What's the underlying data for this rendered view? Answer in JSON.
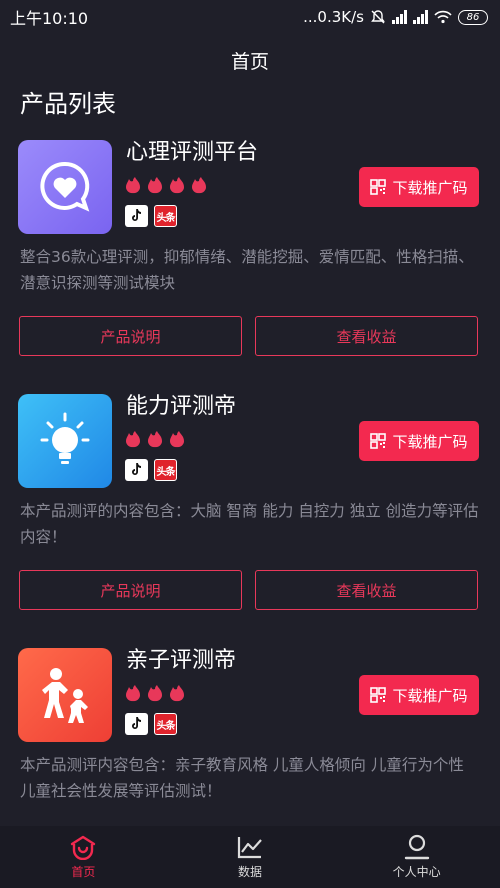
{
  "status": {
    "time": "上午10:10",
    "network": "...0.3K/s",
    "battery": "86"
  },
  "header": {
    "title": "首页"
  },
  "section_title": "产品列表",
  "products": [
    {
      "name": "心理评测平台",
      "rating": 4,
      "badge_toutiao": "头条",
      "qr_label": "下载推广码",
      "description": "整合36款心理评测，抑郁情绪、潜能挖掘、爱情匹配、性格扫描、潜意识探测等测试模块",
      "left_button": "产品说明",
      "right_button": "查看收益",
      "icon_color": "#8f7cf8"
    },
    {
      "name": "能力评测帝",
      "rating": 3,
      "badge_toutiao": "头条",
      "qr_label": "下载推广码",
      "description": "本产品测评的内容包含：大脑 智商 能力 自控力 独立 创造力等评估内容！",
      "left_button": "产品说明",
      "right_button": "查看收益",
      "icon_color": "#2fa8f2"
    },
    {
      "name": "亲子评测帝",
      "rating": 3,
      "badge_toutiao": "头条",
      "qr_label": "下载推广码",
      "description": "本产品测评内容包含：亲子教育风格 儿童人格倾向 儿童行为个性 儿童社会性发展等评估测试！",
      "icon_color": "#f2553e"
    }
  ],
  "tabs": [
    {
      "label": "首页",
      "icon": "home-icon",
      "active": true
    },
    {
      "label": "数据",
      "icon": "chart-icon",
      "active": false
    },
    {
      "label": "个人中心",
      "icon": "profile-icon",
      "active": false
    }
  ],
  "colors": {
    "accent": "#f3294f",
    "background": "#1f1f29",
    "muted_text": "#8a8a96"
  }
}
